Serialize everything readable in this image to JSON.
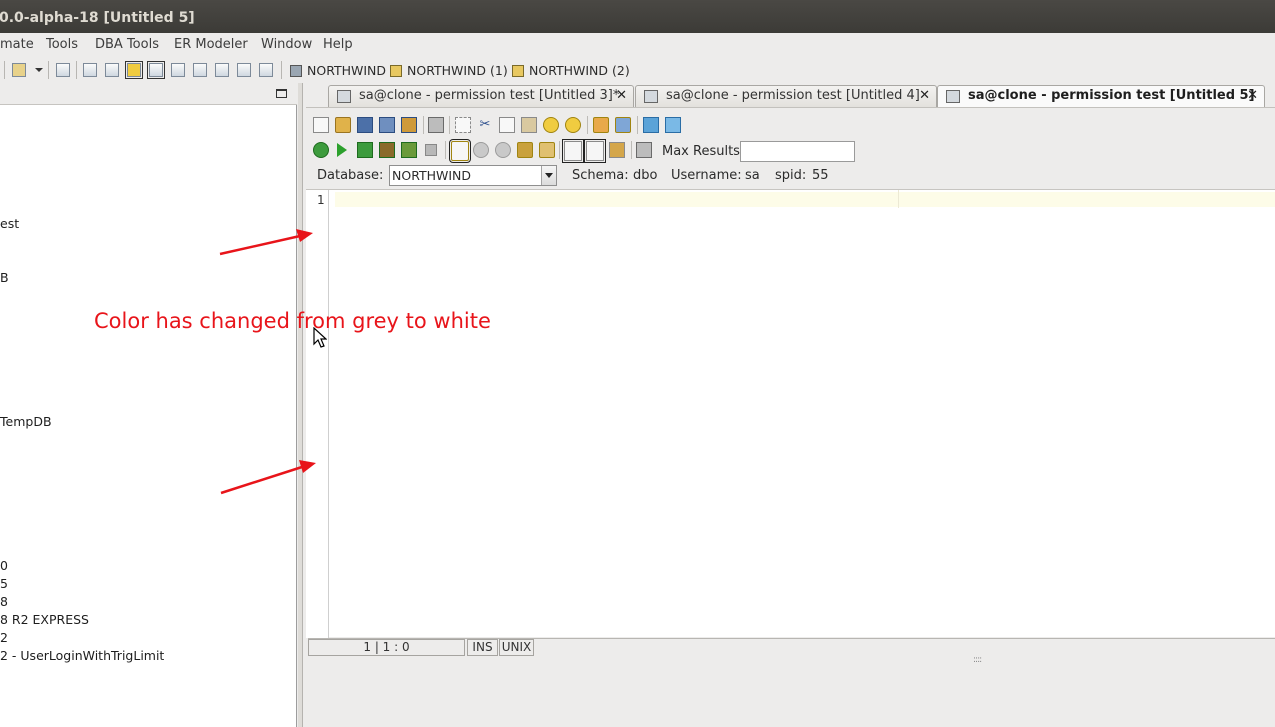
{
  "window": {
    "title": "0.0-alpha-18 [Untitled 5]"
  },
  "menubar": {
    "items": [
      {
        "label": "mate"
      },
      {
        "label": "Tools"
      },
      {
        "label": "DBA Tools"
      },
      {
        "label": "ER Modeler"
      },
      {
        "label": "Window"
      },
      {
        "label": "Help"
      }
    ]
  },
  "toolbar": {
    "connections": [
      {
        "label": "NORTHWIND"
      },
      {
        "label": "NORTHWIND (1)"
      },
      {
        "label": "NORTHWIND (2)"
      }
    ]
  },
  "left_panel": {
    "items": [
      {
        "label": "est"
      },
      {
        "label": "B"
      },
      {
        "label": "TempDB"
      },
      {
        "label": "0"
      },
      {
        "label": "5"
      },
      {
        "label": "8"
      },
      {
        "label": "8 R2 EXPRESS"
      },
      {
        "label": "2"
      },
      {
        "label": "2 - UserLoginWithTrigLimit"
      }
    ]
  },
  "tabs": [
    {
      "label": "sa@clone - permission test [Untitled 3]*",
      "close": "✕",
      "active": false
    },
    {
      "label": "sa@clone - permission test [Untitled 4]",
      "close": "✕",
      "active": false
    },
    {
      "label": "sa@clone - permission test [Untitled 5]",
      "close": "✕",
      "active": true
    }
  ],
  "sql_panel": {
    "max_results_label": "Max Results:",
    "max_results_value": "",
    "database_label": "Database:",
    "database_value": "NORTHWIND",
    "schema_label": "Schema:",
    "schema_value": "dbo",
    "username_label": "Username:",
    "username_value": "sa",
    "spid_label": "spid:",
    "spid_value": "55"
  },
  "editor": {
    "line_number": "1",
    "content": ""
  },
  "status_bar": {
    "position": "1 | 1 : 0",
    "mode": "INS",
    "line_endings": "UNIX",
    "grip": "::::"
  },
  "annotation": {
    "text": "Color has changed from grey to white",
    "color": "#e8141a"
  },
  "colors": {
    "title_bar": "#3c3b37",
    "panel_bg": "#edeceb",
    "editor_bg": "#ffffff",
    "current_line": "#fdfce8"
  }
}
